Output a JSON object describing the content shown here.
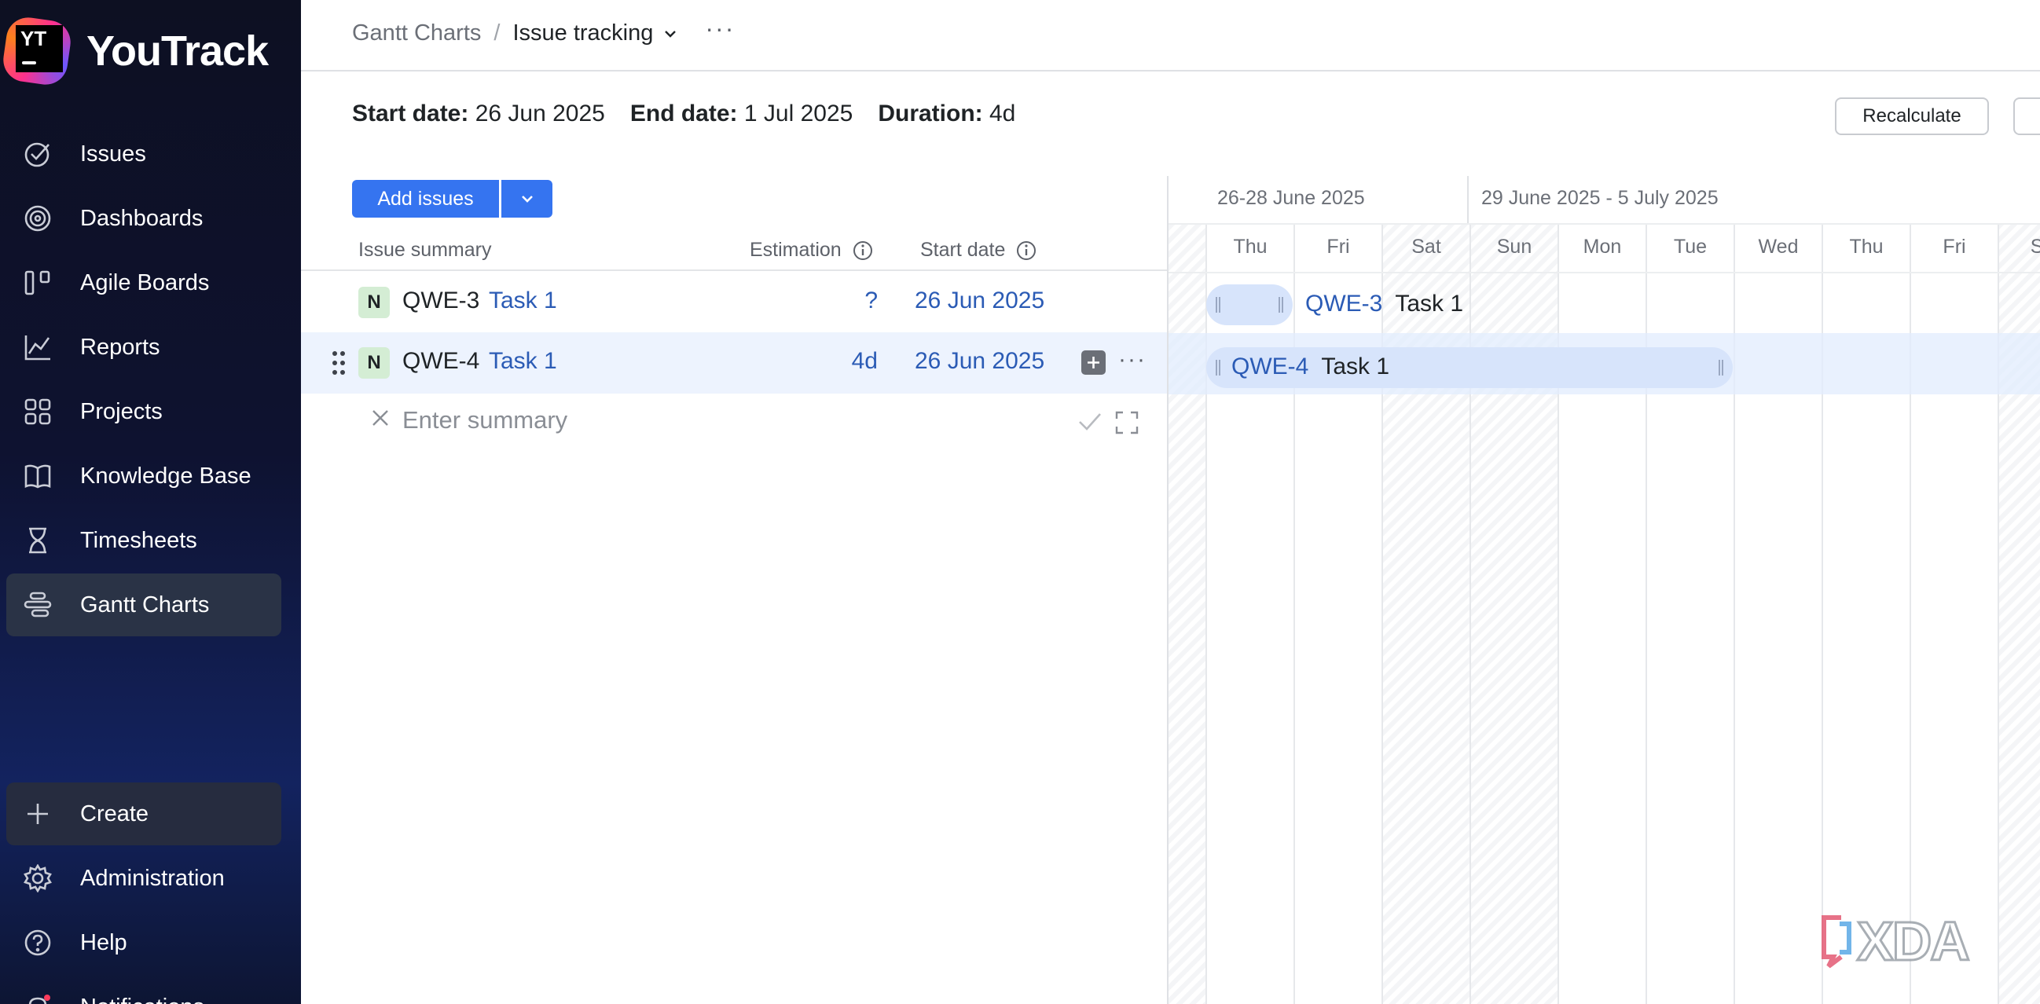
{
  "app": {
    "name": "YouTrack",
    "logo_mark": "YT"
  },
  "sidebar": {
    "items": [
      {
        "label": "Issues",
        "icon": "issues-check-icon"
      },
      {
        "label": "Dashboards",
        "icon": "dashboards-icon"
      },
      {
        "label": "Agile Boards",
        "icon": "agile-boards-icon"
      },
      {
        "label": "Reports",
        "icon": "reports-chart-icon"
      },
      {
        "label": "Projects",
        "icon": "projects-grid-icon"
      },
      {
        "label": "Knowledge Base",
        "icon": "knowledge-base-book-icon"
      },
      {
        "label": "Timesheets",
        "icon": "timesheets-hourglass-icon"
      },
      {
        "label": "Gantt Charts",
        "icon": "gantt-charts-icon",
        "active": true
      }
    ],
    "bottom": [
      {
        "label": "Create",
        "icon": "plus-icon"
      },
      {
        "label": "Administration",
        "icon": "gear-icon"
      },
      {
        "label": "Help",
        "icon": "help-icon"
      },
      {
        "label": "Notifications",
        "icon": "bell-icon"
      }
    ]
  },
  "breadcrumb": {
    "parent": "Gantt Charts",
    "current": "Issue tracking"
  },
  "summary": {
    "start_label": "Start date:",
    "start_value": "26 Jun 2025",
    "end_label": "End date:",
    "end_value": "1 Jul 2025",
    "duration_label": "Duration:",
    "duration_value": "4d"
  },
  "toolbar": {
    "recalculate_label": "Recalculate",
    "add_issues_label": "Add issues"
  },
  "table": {
    "headers": {
      "summary": "Issue summary",
      "estimation": "Estimation",
      "start_date": "Start date"
    },
    "rows": [
      {
        "badge": "N",
        "id": "QWE-3",
        "title": "Task 1",
        "estimation": "?",
        "start_date": "26 Jun 2025",
        "selected": false
      },
      {
        "badge": "N",
        "id": "QWE-4",
        "title": "Task 1",
        "estimation": "4d",
        "start_date": "26 Jun 2025",
        "selected": true
      }
    ],
    "new_row_placeholder": "Enter summary"
  },
  "gantt": {
    "weeks": [
      "26-28 June 2025",
      "29 June 2025 - 5 July 2025"
    ],
    "days": [
      "Thu",
      "Fri",
      "Sat",
      "Sun",
      "Mon",
      "Tue",
      "Wed",
      "Thu",
      "Fri",
      "Sa"
    ],
    "bars": [
      {
        "id": "QWE-3",
        "title": "Task 1"
      },
      {
        "id": "QWE-4",
        "title": "Task 1"
      }
    ]
  },
  "watermark": "XDA",
  "colors": {
    "accent": "#3574f0",
    "link": "#2b5bb5",
    "badge_bg": "#d4edd4",
    "bar": "#d7e4fb"
  }
}
